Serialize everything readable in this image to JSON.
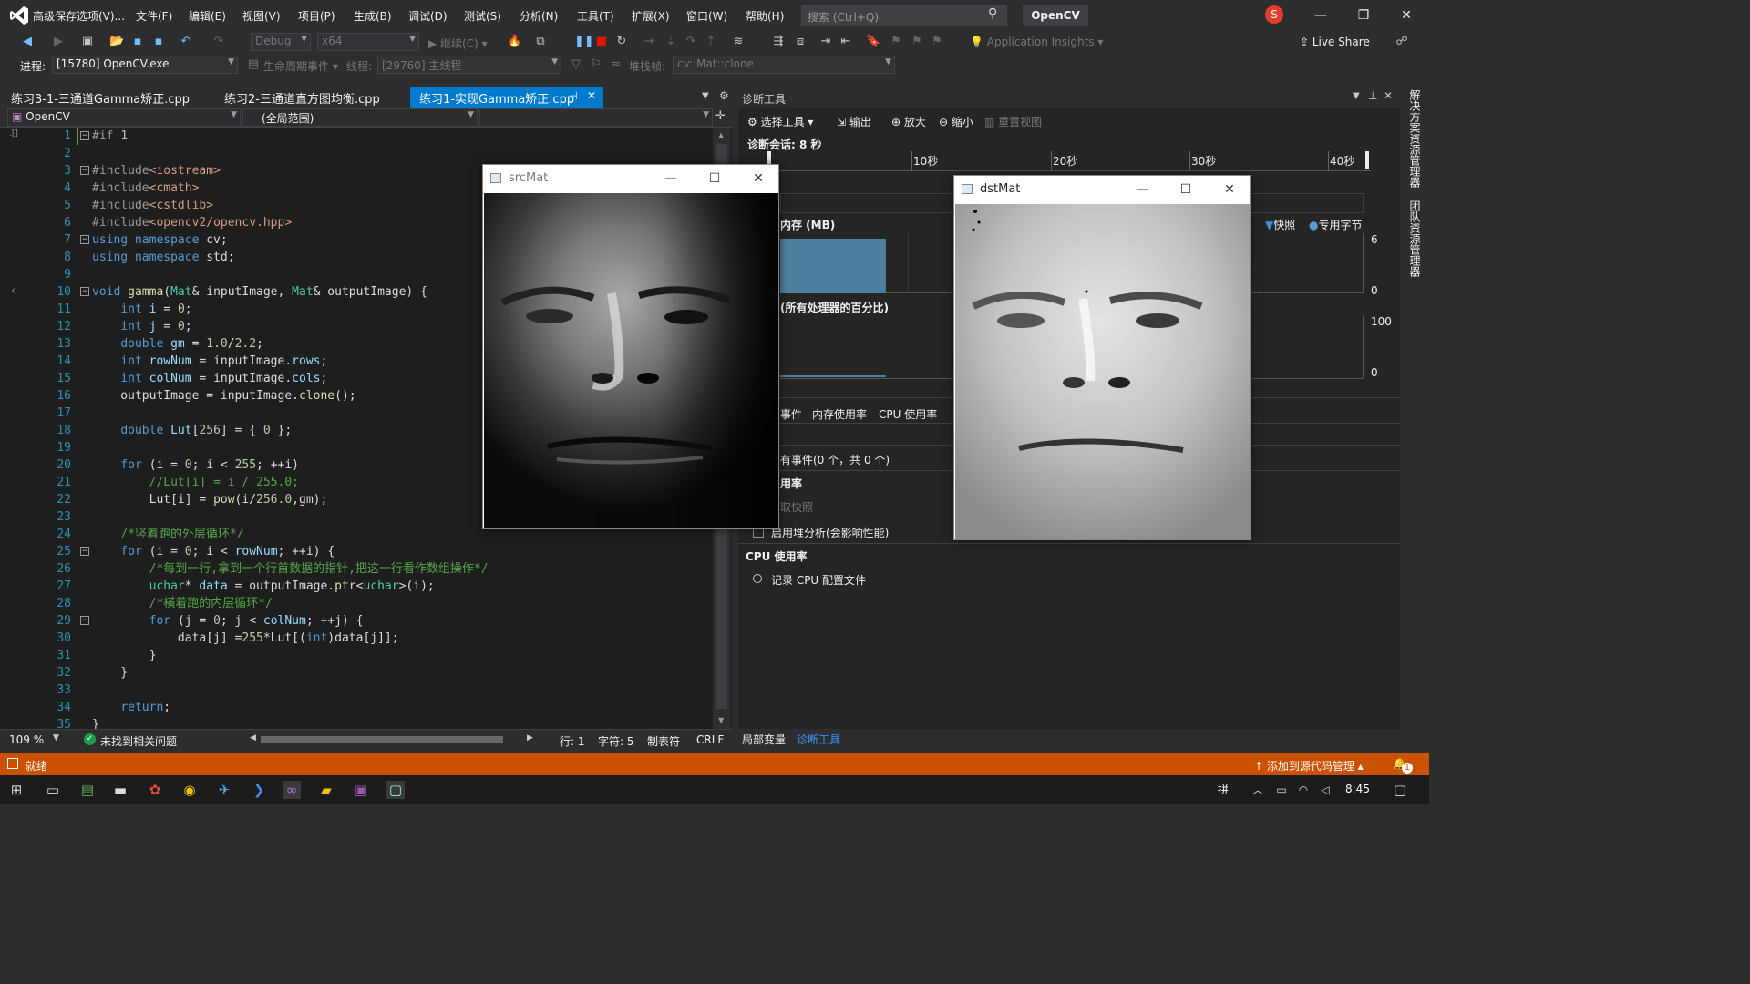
{
  "menu": [
    "高级保存选项(V)...",
    "文件(F)",
    "编辑(E)",
    "视图(V)",
    "项目(P)",
    "生成(B)",
    "调试(D)",
    "测试(S)",
    "分析(N)",
    "工具(T)",
    "扩展(X)",
    "窗口(W)",
    "帮助(H)"
  ],
  "search": {
    "placeholder": "搜索 (Ctrl+Q)"
  },
  "project_name": "OpenCV",
  "avatar_letter": "S",
  "toolbar": {
    "config": "Debug",
    "platform": "x64",
    "continue_label": "继续(C)",
    "app_insights": "Application Insights",
    "live_share": "Live Share"
  },
  "debug_bar": {
    "process_label": "进程:",
    "process_value": "[15780] OpenCV.exe",
    "lifecycle_label": "生命周期事件",
    "thread_label": "线程:",
    "thread_value": "[29760] 主线程",
    "stackframe_label": "堆栈帧:",
    "stackframe_value": "cv::Mat::clone"
  },
  "doc_tabs": [
    {
      "label": "练习3-1-三通道Gamma矫正.cpp",
      "active": false
    },
    {
      "label": "练习2-三通道直方图均衡.cpp",
      "active": false
    },
    {
      "label": "练习1-实现Gamma矫正.cpp",
      "active": true
    }
  ],
  "nav": {
    "project": "OpenCV",
    "scope": "(全局范围)"
  },
  "code_lines": [
    [
      [
        "pp",
        "#if "
      ],
      [
        "nm",
        "1"
      ]
    ],
    [],
    [
      [
        "pp",
        "#include"
      ],
      [
        "st",
        "<iostream>"
      ]
    ],
    [
      [
        "pp",
        "#include"
      ],
      [
        "st",
        "<cmath>"
      ]
    ],
    [
      [
        "pp",
        "#include"
      ],
      [
        "st",
        "<cstdlib>"
      ]
    ],
    [
      [
        "pp",
        "#include"
      ],
      [
        "st",
        "<opencv2/opencv.hpp>"
      ]
    ],
    [
      [
        "kw",
        "using namespace "
      ],
      [
        "tx",
        "cv;"
      ]
    ],
    [
      [
        "kw",
        "using namespace "
      ],
      [
        "tx",
        "std;"
      ]
    ],
    [],
    [
      [
        "kw",
        "void "
      ],
      [
        "fn",
        "gamma"
      ],
      [
        "tx",
        "("
      ],
      [
        "ty",
        "Mat"
      ],
      [
        "tx",
        "& inputImage, "
      ],
      [
        "ty",
        "Mat"
      ],
      [
        "tx",
        "& outputImage) {"
      ]
    ],
    [
      [
        "tx",
        "    "
      ],
      [
        "kw",
        "int "
      ],
      [
        "vr",
        "i"
      ],
      [
        "tx",
        " = "
      ],
      [
        "nm",
        "0"
      ],
      [
        "tx",
        ";"
      ]
    ],
    [
      [
        "tx",
        "    "
      ],
      [
        "kw",
        "int "
      ],
      [
        "vr",
        "j"
      ],
      [
        "tx",
        " = "
      ],
      [
        "nm",
        "0"
      ],
      [
        "tx",
        ";"
      ]
    ],
    [
      [
        "tx",
        "    "
      ],
      [
        "kw",
        "double "
      ],
      [
        "vr",
        "gm"
      ],
      [
        "tx",
        " = "
      ],
      [
        "nm",
        "1.0"
      ],
      [
        "tx",
        "/"
      ],
      [
        "nm",
        "2.2"
      ],
      [
        "tx",
        ";"
      ]
    ],
    [
      [
        "tx",
        "    "
      ],
      [
        "kw",
        "int "
      ],
      [
        "vr",
        "rowNum"
      ],
      [
        "tx",
        " = inputImage."
      ],
      [
        "vr",
        "rows"
      ],
      [
        "tx",
        ";"
      ]
    ],
    [
      [
        "tx",
        "    "
      ],
      [
        "kw",
        "int "
      ],
      [
        "vr",
        "colNum"
      ],
      [
        "tx",
        " = inputImage."
      ],
      [
        "vr",
        "cols"
      ],
      [
        "tx",
        ";"
      ]
    ],
    [
      [
        "tx",
        "    outputImage = inputImage."
      ],
      [
        "fn",
        "clone"
      ],
      [
        "tx",
        "();"
      ]
    ],
    [],
    [
      [
        "tx",
        "    "
      ],
      [
        "kw",
        "double "
      ],
      [
        "vr",
        "Lut"
      ],
      [
        "tx",
        "["
      ],
      [
        "nm",
        "256"
      ],
      [
        "tx",
        "] = { "
      ],
      [
        "nm",
        "0"
      ],
      [
        "tx",
        " };"
      ]
    ],
    [],
    [
      [
        "tx",
        "    "
      ],
      [
        "kw",
        "for"
      ],
      [
        "tx",
        " (i = "
      ],
      [
        "nm",
        "0"
      ],
      [
        "tx",
        "; i < "
      ],
      [
        "nm",
        "255"
      ],
      [
        "tx",
        "; ++i)"
      ]
    ],
    [
      [
        "tx",
        "        "
      ],
      [
        "cm",
        "//Lut[i] = i / 255.0;"
      ]
    ],
    [
      [
        "tx",
        "        Lut[i] = "
      ],
      [
        "fn",
        "pow"
      ],
      [
        "tx",
        "(i/"
      ],
      [
        "nm",
        "256.0"
      ],
      [
        "tx",
        ",gm);"
      ]
    ],
    [],
    [
      [
        "tx",
        "    "
      ],
      [
        "cm",
        "/*竖着跑的外层循环*/"
      ]
    ],
    [
      [
        "tx",
        "    "
      ],
      [
        "kw",
        "for"
      ],
      [
        "tx",
        " (i = "
      ],
      [
        "nm",
        "0"
      ],
      [
        "tx",
        "; i < "
      ],
      [
        "vr",
        "rowNum"
      ],
      [
        "tx",
        "; ++i) {"
      ]
    ],
    [
      [
        "tx",
        "        "
      ],
      [
        "cm",
        "/*每到一行,拿到一个行首数据的指针,把这一行看作数组操作*/"
      ]
    ],
    [
      [
        "tx",
        "        "
      ],
      [
        "ty",
        "uchar"
      ],
      [
        "tx",
        "* "
      ],
      [
        "vr",
        "data"
      ],
      [
        "tx",
        " = outputImage."
      ],
      [
        "fn",
        "ptr"
      ],
      [
        "tx",
        "<"
      ],
      [
        "ty",
        "uchar"
      ],
      [
        "tx",
        ">(i);"
      ]
    ],
    [
      [
        "tx",
        "        "
      ],
      [
        "cm",
        "/*横着跑的内层循环*/"
      ]
    ],
    [
      [
        "tx",
        "        "
      ],
      [
        "kw",
        "for"
      ],
      [
        "tx",
        " (j = "
      ],
      [
        "nm",
        "0"
      ],
      [
        "tx",
        "; j < "
      ],
      [
        "vr",
        "colNum"
      ],
      [
        "tx",
        "; ++j) {"
      ]
    ],
    [
      [
        "tx",
        "            data[j] ="
      ],
      [
        "nm",
        "255"
      ],
      [
        "tx",
        "*Lut[("
      ],
      [
        "kw",
        "int"
      ],
      [
        "tx",
        ")data[j]];"
      ]
    ],
    [
      [
        "tx",
        "        }"
      ]
    ],
    [
      [
        "tx",
        "    }"
      ]
    ],
    [],
    [
      [
        "tx",
        "    "
      ],
      [
        "kw",
        "return"
      ],
      [
        "tx",
        ";"
      ]
    ],
    [
      [
        "tx",
        "}"
      ]
    ]
  ],
  "editor_status": {
    "zoom": "109 %",
    "issues": "未找到相关问题",
    "line": "行: 1",
    "char": "字符: 5",
    "tab": "制表符",
    "eol": "CRLF"
  },
  "diag": {
    "title": "诊断工具",
    "select_tool": "选择工具",
    "output": "输出",
    "zoom_in": "放大",
    "zoom_out": "缩小",
    "reset_view": "重置视图",
    "session": "诊断会话: 8 秒",
    "ticks": [
      "10秒",
      "20秒",
      "30秒",
      "40秒"
    ],
    "memory_header": "内存 (MB)",
    "legend_snapshot": "快照",
    "legend_private": "专用字节",
    "mem_max": "6",
    "mem_min": "0",
    "cpu_header": "(所有处理器的百分比)",
    "cpu_max": "100",
    "cpu_min": "0",
    "tabs": [
      "事件",
      "内存使用率",
      "CPU 使用率"
    ],
    "events_text": "有事件(0 个，共 0 个)",
    "mem_usage": "用率",
    "take_snapshot": "取快照",
    "heap_analysis": "启用堆分析(会影响性能)",
    "cpu_section": "CPU 使用率",
    "record_cpu": "记录 CPU 配置文件"
  },
  "bottom_tabs": [
    "局部变量",
    "诊断工具"
  ],
  "right_strip": [
    "解决方案资源管理器",
    "团队资源管理器"
  ],
  "windows": {
    "src": "srcMat",
    "dst": "dstMat"
  },
  "status": {
    "ready": "就绪",
    "source_control": "添加到源代码管理",
    "notifications": "1"
  },
  "taskbar": {
    "ime": "拼",
    "time": "8:45"
  },
  "colors": {
    "accent": "#007acc",
    "status_bar": "#ca5100",
    "memory_bar": "#4e7f9e"
  }
}
